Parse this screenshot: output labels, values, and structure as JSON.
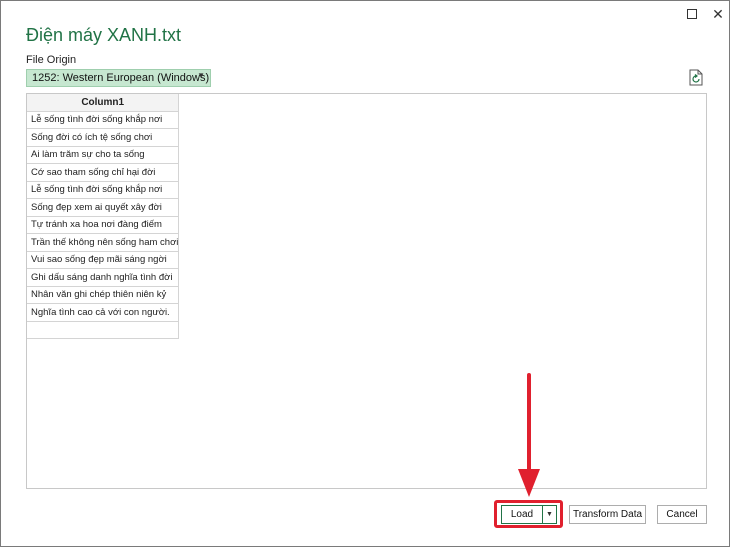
{
  "window": {
    "title": "Điện máy XANH.txt",
    "maximize_icon": "maximize-icon",
    "close_glyph": "✕"
  },
  "file_origin": {
    "label": "File Origin",
    "selected": "1252: Western European (Windows)",
    "chevron": "▼"
  },
  "preview": {
    "column_header": "Column1",
    "rows": [
      "Lễ sống tình đời sống khắp nơi",
      "Sống đời có ích tệ sống chơi",
      "Ai làm trăm sự cho ta sống",
      "Cớ sao tham sống chỉ hại đời",
      "Lễ sống tình đời sống khắp nơi",
      "Sống đẹp xem ai quyết xây đời",
      "Tự tránh xa hoa nơi đàng điếm",
      "Trần thế không nên sống ham chơi",
      "Vui sao sống đẹp mãi sáng ngời",
      "Ghi dấu sáng danh nghĩa tình đời",
      "Nhân văn ghi chép thiên niên kỷ",
      "Nghĩa tình cao cả với con người.",
      ""
    ]
  },
  "buttons": {
    "load": "Load",
    "load_dropdown": "▼",
    "transform": "Transform Data",
    "cancel": "Cancel"
  },
  "colors": {
    "accent": "#217346",
    "select_bg": "#c6e7d0",
    "highlight": "#e0202e"
  }
}
